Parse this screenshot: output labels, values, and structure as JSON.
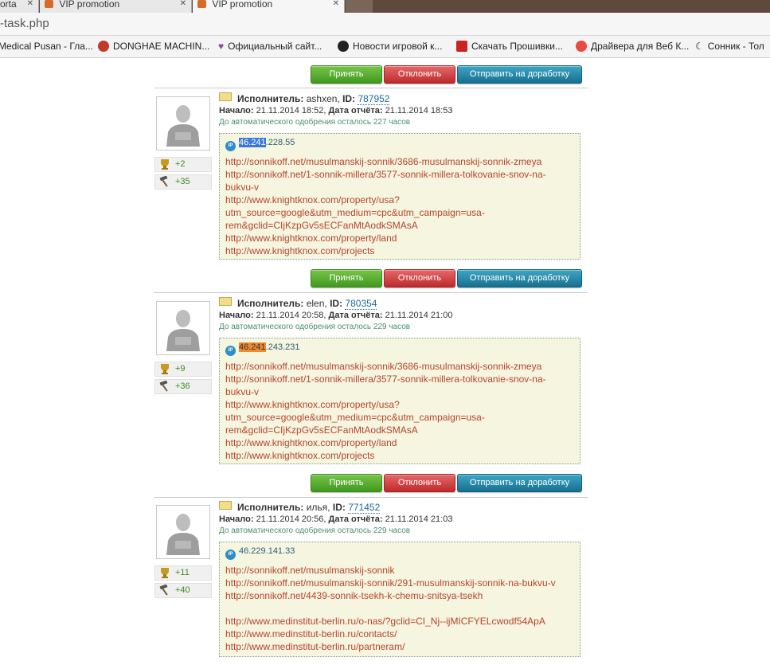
{
  "browser": {
    "tabs": [
      {
        "label": "orta",
        "active": false
      },
      {
        "label": "VIP promotion",
        "active": false
      },
      {
        "label": "VIP promotion",
        "active": true
      }
    ],
    "address": "-task.php",
    "bookmarks": [
      {
        "label": "Medical Pusan - Гла...",
        "icon": "none"
      },
      {
        "label": "DONGHAE MACHIN...",
        "icon": "gear-red",
        "color": "#c0392b"
      },
      {
        "label": "Официальный сайт...",
        "icon": "heart",
        "color": "#8e44ad"
      },
      {
        "label": "Новости игровой к...",
        "icon": "play",
        "color": "#222222"
      },
      {
        "label": "Скачать Прошивки...",
        "icon": "info-red",
        "color": "#cc2222"
      },
      {
        "label": "Драйвера для Веб К...",
        "icon": "circle-red",
        "color": "#e74c3c"
      },
      {
        "label": "Сонник - Тол",
        "icon": "moon",
        "color": "#333333"
      }
    ]
  },
  "buttons": {
    "accept": "Принять",
    "reject": "Отклонить",
    "rework": "Отправить на доработку"
  },
  "labels": {
    "executor": "Исполнитель:",
    "id": "ID:",
    "start": "Начало:",
    "report_date": "Дата отчёта:",
    "ip_badge": "IP"
  },
  "reports": [
    {
      "executor": "ashxen",
      "id": "787952",
      "start": "21.11.2014 18:52,",
      "report_date": "21.11.2014 18:53",
      "auto_approve": "До автоматического одобрения осталось 227 часов",
      "trophies": "+2",
      "hammer": "+35",
      "ip_prefix": "46.241",
      "ip_rest": ".228.55",
      "ip_highlight": "blue",
      "urls": [
        "http://sonnikoff.net/musulmanskij-sonnik/3686-musulmanskij-sonnik-zmeya",
        "http://sonnikoff.net/1-sonnik-millera/3577-sonnik-millera-tolkovanie-snov-na-",
        "bukvu-v",
        "http://www.knightknox.com/property/usa?",
        "utm_source=google&utm_medium=cpc&utm_campaign=usa-",
        "rem&gclid=CIjKzpGv5sECFanMtAodkSMAsA",
        "http://www.knightknox.com/property/land",
        "http://www.knightknox.com/projects"
      ]
    },
    {
      "executor": "elen",
      "id": "780354",
      "start": "21.11.2014 20:58,",
      "report_date": "21.11.2014 21:00",
      "auto_approve": "До автоматического одобрения осталось 229 часов",
      "trophies": "+9",
      "hammer": "+36",
      "ip_prefix": "46.241",
      "ip_rest": ".243.231",
      "ip_highlight": "orange",
      "urls": [
        "http://sonnikoff.net/musulmanskij-sonnik/3686-musulmanskij-sonnik-zmeya",
        "http://sonnikoff.net/1-sonnik-millera/3577-sonnik-millera-tolkovanie-snov-na-",
        "bukvu-v",
        "http://www.knightknox.com/property/usa?",
        "utm_source=google&utm_medium=cpc&utm_campaign=usa-",
        "rem&gclid=CIjKzpGv5sECFanMtAodkSMAsA",
        "http://www.knightknox.com/property/land",
        "http://www.knightknox.com/projects"
      ]
    },
    {
      "executor": "илья",
      "id": "771452",
      "start": "21.11.2014 20:56,",
      "report_date": "21.11.2014 21:03",
      "auto_approve": "До автоматического одобрения осталось 229 часов",
      "trophies": "+11",
      "hammer": "+40",
      "ip_prefix": "46.229.141.33",
      "ip_rest": "",
      "ip_highlight": "none",
      "urls": [
        "http://sonnikoff.net/musulmanskij-sonnik",
        "http://sonnikoff.net/musulmanskij-sonnik/291-musulmanskij-sonnik-na-bukvu-v",
        "http://sonnikoff.net/4439-sonnik-tsekh-k-chemu-snitsya-tsekh",
        "",
        "http://www.medinstitut-berlin.ru/o-nas/?gclid=CI_Nj--ijMICFYELcwodf54ApA",
        "http://www.medinstitut-berlin.ru/contacts/",
        "http://www.medinstitut-berlin.ru/partneram/"
      ]
    }
  ]
}
